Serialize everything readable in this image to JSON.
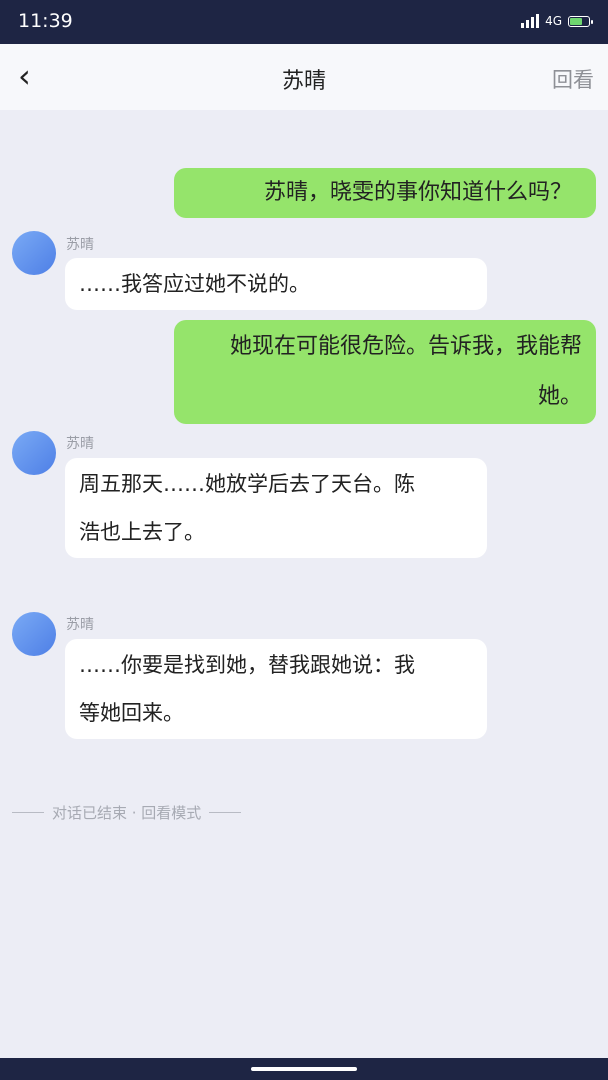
{
  "status": {
    "time": "11:39",
    "network": "4G",
    "signal_icon": "signal-icon",
    "battery_icon": "battery-icon"
  },
  "header": {
    "back_icon": "chevron-left-icon",
    "back_glyph": "‹",
    "title": "苏晴",
    "review_label": "回看"
  },
  "messages": [
    {
      "from": "me",
      "text": "苏晴，晓雯的事你知道什么吗？"
    },
    {
      "from": "other",
      "name": "苏晴",
      "text": "……我答应过她不说的。"
    },
    {
      "from": "me",
      "text_lines": [
        "她现在可能很危险。告诉我，我能帮",
        "她。"
      ]
    },
    {
      "from": "other",
      "name": "苏晴",
      "text_lines": [
        "周五那天……她放学后去了天台。陈",
        "浩也上去了。"
      ]
    },
    {
      "from": "other",
      "name": "苏晴",
      "text_lines": [
        "……你要是找到她，替我跟她说：我",
        "等她回来。"
      ]
    }
  ],
  "system_note": "对话已结束 · 回看模式",
  "colors": {
    "my_bubble": "#95e46b",
    "other_bubble": "#ffffff",
    "background": "#ecedf5",
    "status_bar": "#1e2544"
  }
}
